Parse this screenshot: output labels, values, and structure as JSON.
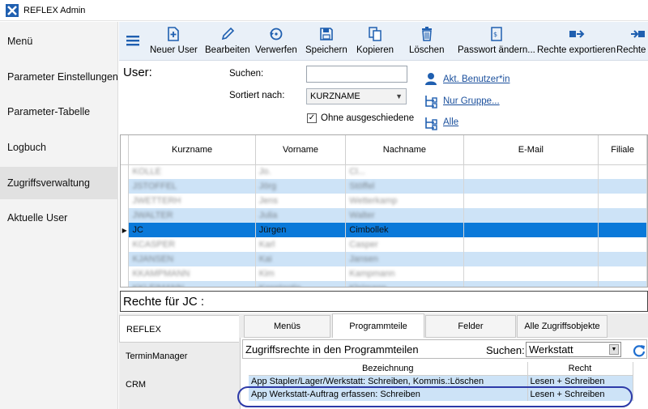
{
  "window": {
    "title": "REFLEX Admin"
  },
  "nav": {
    "items": [
      {
        "label": "Menü"
      },
      {
        "label": "Parameter Einstellungen"
      },
      {
        "label": "Parameter-Tabelle"
      },
      {
        "label": "Logbuch"
      },
      {
        "label": "Zugriffsverwaltung",
        "active": true
      },
      {
        "label": "Aktuelle User"
      }
    ]
  },
  "toolbar": {
    "new_user": "Neuer User",
    "edit": "Bearbeiten",
    "discard": "Verwerfen",
    "save": "Speichern",
    "copy": "Kopieren",
    "delete": "Löschen",
    "password": "Passwort ändern...",
    "export": "Rechte exportieren",
    "more": "Rechte im",
    "accent": "#1f5fb0"
  },
  "filter": {
    "user_label": "User:",
    "search_label": "Suchen:",
    "search_value": "",
    "sort_label": "Sortiert nach:",
    "sort_value": "KURZNAME",
    "hide_retired_label": "Ohne ausgeschiedene",
    "hide_retired_checked": "✓",
    "link_current_user": "Akt. Benutzer*in",
    "link_group_only": "Nur Gruppe...",
    "link_all": "Alle"
  },
  "users": {
    "columns": [
      "Kurzname",
      "Vorname",
      "Nachname",
      "E-Mail",
      "Filiale"
    ],
    "rows": [
      {
        "kurz": "",
        "vor": "",
        "nach": ""
      },
      {
        "kurz": "",
        "vor": "",
        "nach": ""
      },
      {
        "kurz": "",
        "vor": "",
        "nach": ""
      },
      {
        "kurz": "",
        "vor": "",
        "nach": ""
      },
      {
        "kurz": "JC",
        "vor": "Jürgen",
        "nach": "Cimbollek"
      },
      {
        "kurz": "",
        "vor": "",
        "nach": ""
      },
      {
        "kurz": "",
        "vor": "",
        "nach": ""
      },
      {
        "kurz": "",
        "vor": "",
        "nach": ""
      },
      {
        "kurz": "",
        "vor": "",
        "nach": ""
      }
    ]
  },
  "rechte_bar": {
    "label": "Rechte für  JC :"
  },
  "categories": [
    "REFLEX",
    "TerminManager",
    "CRM"
  ],
  "tabs": [
    "Menüs",
    "Programmteile",
    "Felder",
    "Alle Zugriffsobjekte"
  ],
  "programmteile": {
    "title": "Zugriffsrechte in den Programmteilen",
    "search_label": "Suchen:",
    "search_value": "Werkstatt",
    "columns": [
      "Bezeichnung",
      "Recht"
    ],
    "rows": [
      {
        "bez": "App Stapler/Lager/Werkstatt: Schreiben, Kommis.:Löschen",
        "recht": "Lesen + Schreiben"
      },
      {
        "bez": "App Werkstatt-Auftrag erfassen: Schreiben",
        "recht": "Lesen + Schreiben"
      }
    ]
  }
}
